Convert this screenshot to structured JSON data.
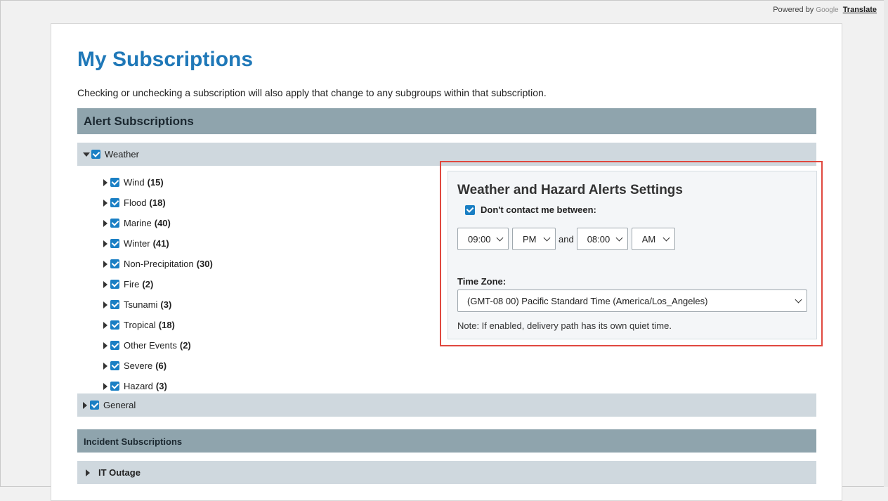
{
  "translate": {
    "powered_by": "Powered by",
    "google": "Google",
    "translate_link": "Translate"
  },
  "page": {
    "title": "My Subscriptions",
    "intro": "Checking or unchecking a subscription will also apply that change to any subgroups within that subscription."
  },
  "alert_section": {
    "title": "Alert Subscriptions"
  },
  "weather_group": {
    "label": "Weather",
    "checked": true,
    "expanded": true
  },
  "subgroups": [
    {
      "label": "Wind",
      "count": "(15)"
    },
    {
      "label": "Flood",
      "count": "(18)"
    },
    {
      "label": "Marine",
      "count": "(40)"
    },
    {
      "label": "Winter",
      "count": "(41)"
    },
    {
      "label": "Non-Precipitation",
      "count": "(30)"
    },
    {
      "label": "Fire",
      "count": "(2)"
    },
    {
      "label": "Tsunami",
      "count": "(3)"
    },
    {
      "label": "Tropical",
      "count": "(18)"
    },
    {
      "label": "Other Events",
      "count": "(2)"
    },
    {
      "label": "Severe",
      "count": "(6)"
    },
    {
      "label": "Hazard",
      "count": "(3)"
    }
  ],
  "general_group": {
    "label": "General",
    "checked": true
  },
  "incident_section": {
    "title": "Incident Subscriptions"
  },
  "it_outage": {
    "label": "IT Outage"
  },
  "settings": {
    "title": "Weather and Hazard Alerts Settings",
    "dnd_label": "Don't contact me between:",
    "dnd_checked": true,
    "start_hour": "09:00",
    "start_ampm": "PM",
    "and_text": "and",
    "end_hour": "08:00",
    "end_ampm": "AM",
    "timezone_label": "Time Zone:",
    "timezone_value": "(GMT-08 00) Pacific Standard Time (America/Los_Angeles)",
    "note": "Note: If enabled, delivery path has its own quiet time."
  },
  "colors": {
    "title_blue": "#1f78b8",
    "checkbox_blue": "#1a7fc4",
    "section_bar": "#8fa4ad",
    "group_row": "#cfd8de",
    "highlight_red": "#e0483f"
  }
}
